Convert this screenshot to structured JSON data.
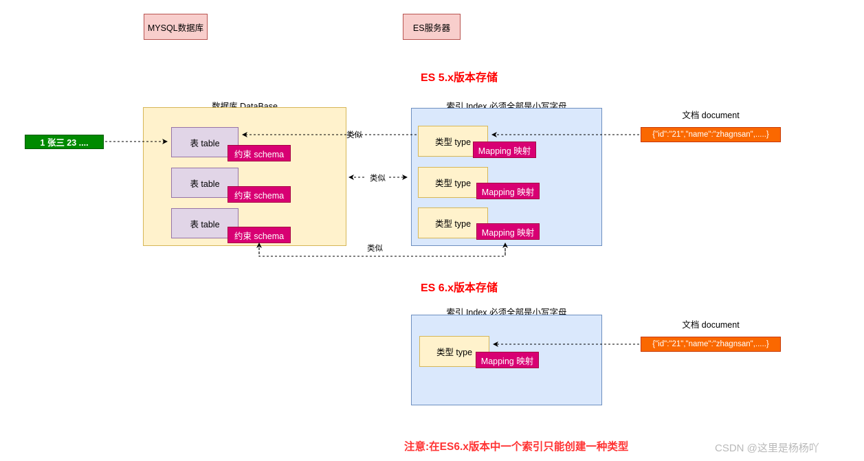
{
  "diagram": {
    "title_mysql": "MYSQL数据库",
    "title_es": "ES服务器",
    "section_es5_title": "ES 5.x版本存储",
    "section_es6_title": "ES 6.x版本存储",
    "note": "注意:在ES6.x版本中一个索引只能创建一种类型",
    "watermark": "CSDN @这里是杨杨吖"
  },
  "mysql": {
    "database_caption": "数据库 DataBase",
    "row_record": "1 张三 23 ....",
    "tables": [
      {
        "label": "表 table",
        "schema": "约束 schema"
      },
      {
        "label": "表 table",
        "schema": "约束 schema"
      },
      {
        "label": "表 table",
        "schema": "约束 schema"
      }
    ]
  },
  "es5": {
    "index_caption": "索引 Index 必须全部是小写字母",
    "document_caption": "文档 document",
    "document_value": "{\"id\":\"21\",\"name\":\"zhagnsan\",.....}",
    "types": [
      {
        "label": "类型 type",
        "mapping": "Mapping 映射"
      },
      {
        "label": "类型 type",
        "mapping": "Mapping 映射"
      },
      {
        "label": "类型 type",
        "mapping": "Mapping 映射"
      }
    ]
  },
  "es6": {
    "index_caption": "索引 Index 必须全部是小写字母",
    "document_caption": "文档 document",
    "document_value": "{\"id\":\"21\",\"name\":\"zhagnsan\",.....}",
    "types": [
      {
        "label": "类型 type",
        "mapping": "Mapping 映射"
      }
    ]
  },
  "connector_labels": {
    "similar_top": "类似",
    "similar_middle": "类似",
    "similar_bottom": "类似"
  },
  "colors": {
    "pink_fill": "#f8cecc",
    "pink_stroke": "#b85450",
    "yellow_fill": "#fff2cc",
    "yellow_stroke": "#d6b656",
    "blue_fill": "#dae8fc",
    "blue_stroke": "#6c8ebf",
    "purple_fill": "#e1d5e7",
    "purple_stroke": "#9673a6",
    "magenta_fill": "#d80073",
    "green_fill": "#008a00",
    "orange_fill": "#fa6800",
    "red_text": "#ff0000"
  }
}
